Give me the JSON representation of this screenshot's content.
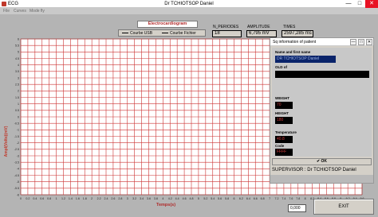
{
  "window": {
    "app_name": "ECG",
    "title": "Dr TCHIOTSOP Daniel",
    "min_glyph": "—",
    "max_glyph": "□",
    "close_glyph": "✕"
  },
  "menu": [
    "File",
    "Curves",
    "Mode fly"
  ],
  "plot": {
    "title": "Electrocardiogram",
    "legend": [
      "Courbe USB",
      "Courbe Fichier"
    ]
  },
  "metrics": {
    "periods_label": "N_PERIODES",
    "periods_value": "18",
    "amplitude_label": "AMPLITUDE",
    "amplitude_value": "6,795 mV",
    "times_label": "TIMES",
    "times_value": "2597,285 ms"
  },
  "exit_label": "EXIT",
  "bottom_value": "0,000",
  "chart_data": {
    "type": "line",
    "xlabel": "Temps(s)",
    "ylabel": "Ampl(Volts)(mV)",
    "xlim": [
      0,
      9.6
    ],
    "ylim": [
      -6,
      6
    ],
    "x_ticks": [
      "0",
      "0.2",
      "0.4",
      "0.6",
      "0.8",
      "1",
      "1.2",
      "1.4",
      "1.6",
      "1.8",
      "2",
      "2.2",
      "2.4",
      "2.6",
      "2.8",
      "3",
      "3.2",
      "3.4",
      "3.6",
      "3.8",
      "4",
      "4.2",
      "4.4",
      "4.6",
      "4.8",
      "5",
      "5.2",
      "5.4",
      "5.6",
      "5.8",
      "6",
      "6.2",
      "6.4",
      "6.6",
      "6.8",
      "7",
      "7.2",
      "7.4",
      "7.6",
      "7.8",
      "8",
      "8.2",
      "8.4",
      "8.6",
      "8.8",
      "9",
      "9.2",
      "9.4",
      "9.6"
    ],
    "y_ticks": [
      "6",
      "5.5",
      "5",
      "4.5",
      "4",
      "3.5",
      "3",
      "2.5",
      "2",
      "1.5",
      "1",
      "0.5",
      "0",
      "-0.5",
      "-1",
      "-1.5",
      "-2",
      "-2.5",
      "-3",
      "-3.5",
      "-4",
      "-4.5",
      "-5",
      "-5.5",
      "-6"
    ],
    "grid": true,
    "series": [],
    "grid_color": "#cc3333"
  },
  "dialog": {
    "title": "Sq information of  patient",
    "min_glyph": "—",
    "max_glyph": "□",
    "close_glyph": "✕",
    "name_label": "Name and first name",
    "name_value": "DR TCHIOTSOP Daniel",
    "old_label": "OLD of",
    "old_value": "",
    "weight_label": "WEIGHT",
    "weight_value": "70",
    "height_label": "HEIGHT",
    "height_value": "180",
    "temperature_label": "Temperature",
    "temperature_value": "40.8",
    "code_label": "Code",
    "code_value": "FFFF",
    "ok_label": "OK",
    "supervisor_text": "SUPERVISOR : Dr TCHIOTSOP Daniel"
  }
}
